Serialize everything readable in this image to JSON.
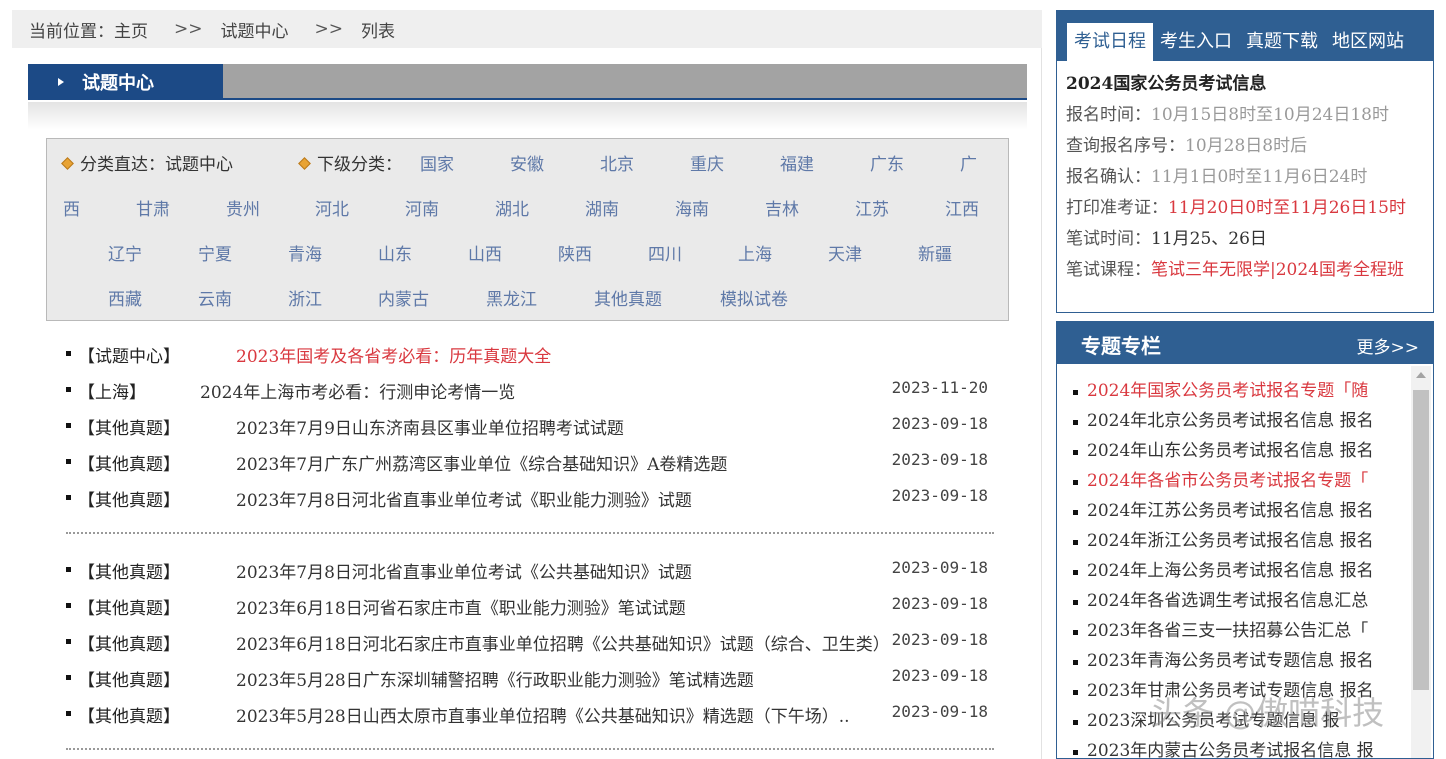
{
  "breadcrumb": {
    "label": "当前位置：",
    "items": [
      "主页",
      "试题中心",
      "列表"
    ],
    "separator": ">>"
  },
  "section": {
    "title": "试题中心"
  },
  "categories": {
    "direct_label": "分类直达：",
    "direct_value": "试题中心",
    "sub_label": "下级分类：",
    "links": [
      "国家",
      "安徽",
      "北京",
      "重庆",
      "福建",
      "广东",
      "广西",
      "甘肃",
      "贵州",
      "河北",
      "河南",
      "湖北",
      "湖南",
      "海南",
      "吉林",
      "江苏",
      "江西",
      "辽宁",
      "宁夏",
      "青海",
      "山东",
      "山西",
      "陕西",
      "四川",
      "上海",
      "天津",
      "新疆",
      "西藏",
      "云南",
      "浙江",
      "内蒙古",
      "黑龙江",
      "其他真题",
      "模拟试卷"
    ]
  },
  "news": [
    {
      "tag": "【试题中心】",
      "title": "2023年国考及各省考必看：历年真题大全",
      "date": "",
      "highlight": true
    },
    {
      "tag": "【上海】",
      "title": "2024年上海市考必看：行测申论考情一览",
      "date": "2023-11-20",
      "highlight": false
    },
    {
      "tag": "【其他真题】",
      "title": "2023年7月9日山东济南县区事业单位招聘考试试题",
      "date": "2023-09-18",
      "highlight": false
    },
    {
      "tag": "【其他真题】",
      "title": "2023年7月广东广州荔湾区事业单位《综合基础知识》A卷精选题",
      "date": "2023-09-18",
      "highlight": false
    },
    {
      "tag": "【其他真题】",
      "title": "2023年7月8日河北省直事业单位考试《职业能力测验》试题",
      "date": "2023-09-18",
      "highlight": false
    },
    {
      "tag": "【其他真题】",
      "title": "2023年7月8日河北省直事业单位考试《公共基础知识》试题",
      "date": "2023-09-18",
      "highlight": false
    },
    {
      "tag": "【其他真题】",
      "title": "2023年6月18日河省石家庄市直《职业能力测验》笔试试题",
      "date": "2023-09-18",
      "highlight": false
    },
    {
      "tag": "【其他真题】",
      "title": "2023年6月18日河北石家庄市直事业单位招聘《公共基础知识》试题（综合、卫生类）",
      "date": "2023-09-18",
      "highlight": false
    },
    {
      "tag": "【其他真题】",
      "title": "2023年5月28日广东深圳辅警招聘《行政职业能力测验》笔试精选题",
      "date": "2023-09-18",
      "highlight": false
    },
    {
      "tag": "【其他真题】",
      "title": "2023年5月28日山西太原市直事业单位招聘《公共基础知识》精选题（下午场）..",
      "date": "2023-09-18",
      "highlight": false
    }
  ],
  "exam": {
    "tabs": [
      "考试日程",
      "考生入口",
      "真题下载",
      "地区网站"
    ],
    "active_tab": 0,
    "title": "2024国家公务员考试信息",
    "lines": [
      {
        "label": "报名时间：",
        "value": "10月15日8时至10月24日18时",
        "style": "muted"
      },
      {
        "label": "查询报名序号：",
        "value": "10月28日8时后",
        "style": "muted"
      },
      {
        "label": "报名确认：",
        "value": "11月1日0时至11月6日24时",
        "style": "muted"
      },
      {
        "label": "打印准考证：",
        "value": "11月20日0时至11月26日15时",
        "style": "red"
      },
      {
        "label": "笔试时间：",
        "value": "11月25、26日",
        "style": "dark"
      },
      {
        "label": "笔试课程：",
        "value": "笔试三年无限学|2024国考全程班",
        "style": "red"
      }
    ]
  },
  "topics": {
    "title": "专题专栏",
    "more": "更多>>",
    "items": [
      {
        "text": "2024年国家公务员考试报名专题「随",
        "highlight": true
      },
      {
        "text": "2024年北京公务员考试报名信息 报名",
        "highlight": false
      },
      {
        "text": "2024年山东公务员考试报名信息 报名",
        "highlight": false
      },
      {
        "text": "2024年各省市公务员考试报名专题「",
        "highlight": true
      },
      {
        "text": "2024年江苏公务员考试报名信息 报名",
        "highlight": false
      },
      {
        "text": "2024年浙江公务员考试报名信息 报名",
        "highlight": false
      },
      {
        "text": "2024年上海公务员考试报名信息 报名",
        "highlight": false
      },
      {
        "text": "2024年各省选调生考试报名信息汇总",
        "highlight": false
      },
      {
        "text": "2023年各省三支一扶招募公告汇总「",
        "highlight": false
      },
      {
        "text": "2023年青海公务员考试专题信息 报名",
        "highlight": false
      },
      {
        "text": "2023年甘肃公务员考试专题信息 报名",
        "highlight": false
      },
      {
        "text": "2023深圳公务员考试专题信息 报",
        "highlight": false
      },
      {
        "text": "2023年内蒙古公务员考试报名信息 报",
        "highlight": false
      }
    ]
  },
  "watermark": "头条 @傲喵科技",
  "colors": {
    "navy": "#1c4a86",
    "panel_blue": "#2f5f92",
    "link": "#5f79a8",
    "red": "#d9383f"
  },
  "icons": {
    "list_bullet": "square-bullet-icon",
    "category_marker": "diamond-icon",
    "section_marker": "triangle-right-icon"
  }
}
